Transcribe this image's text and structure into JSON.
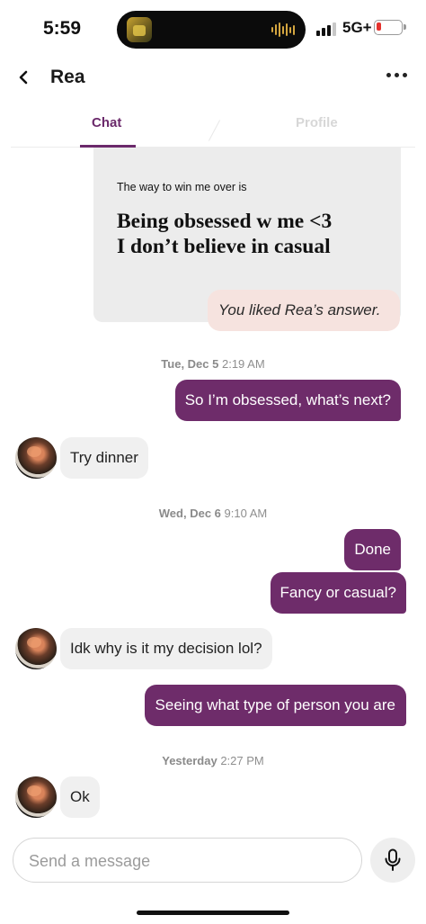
{
  "status_bar": {
    "time": "5:59",
    "network": "5G+",
    "battery_level": 0.12,
    "battery_color": "#e5322d",
    "icons": [
      "live-activity-app-icon",
      "audio-waveform-icon",
      "cellular-signal-icon",
      "battery-icon"
    ]
  },
  "header": {
    "back_icon": "chevron-left-icon",
    "name": "Rea",
    "more_icon": "more-horizontal-icon"
  },
  "tabs": [
    {
      "label": "Chat",
      "active": true
    },
    {
      "label": "Profile",
      "active": false
    }
  ],
  "prompt_card": {
    "question": "The way to win me over is",
    "answer_lines": [
      "Being obsessed w me <3",
      "I don’t believe in casual"
    ],
    "liked_text": "You liked Rea’s answer."
  },
  "conversation": {
    "ts1": {
      "day": "Tue, Dec 5",
      "time": "2:19 AM"
    },
    "msg1": "So I’m obsessed, what’s next?",
    "msg2": "Try dinner",
    "ts2": {
      "day": "Wed, Dec 6",
      "time": "9:10 AM"
    },
    "msg3": "Done",
    "msg4": "Fancy or casual?",
    "msg5": "Idk why is it my decision lol?",
    "msg6": "Seeing what type of person you are",
    "ts3": {
      "day": "Yesterday",
      "time": "2:27 PM"
    },
    "msg7": "Ok"
  },
  "composer": {
    "placeholder": "Send a message",
    "value": "",
    "mic_icon": "microphone-icon"
  },
  "colors": {
    "accent": "#6e2c6a",
    "sent_bubble": "#6e2c6a",
    "received_bubble": "#f0f0f0",
    "liked_badge": "#f6e3df",
    "prompt_card": "#ececec"
  }
}
